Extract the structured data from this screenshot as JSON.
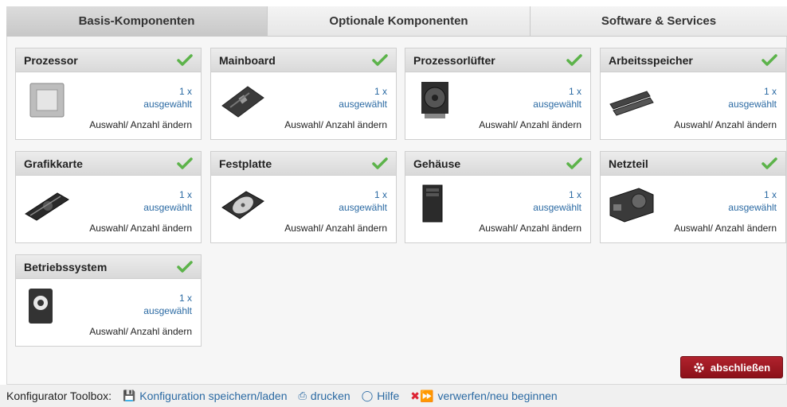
{
  "tabs": [
    {
      "label": "Basis-Komponenten",
      "active": true
    },
    {
      "label": "Optionale Komponenten",
      "active": false
    },
    {
      "label": "Software & Services",
      "active": false
    }
  ],
  "cards": [
    {
      "title": "Prozessor",
      "qty": "1 x",
      "selected": "ausgewählt",
      "change": "Auswahl/ Anzahl ändern",
      "icon": "cpu-icon"
    },
    {
      "title": "Mainboard",
      "qty": "1 x",
      "selected": "ausgewählt",
      "change": "Auswahl/ Anzahl ändern",
      "icon": "motherboard-icon"
    },
    {
      "title": "Prozessorlüfter",
      "qty": "1 x",
      "selected": "ausgewählt",
      "change": "Auswahl/ Anzahl ändern",
      "icon": "cpu-cooler-icon"
    },
    {
      "title": "Arbeitsspeicher",
      "qty": "1 x",
      "selected": "ausgewählt",
      "change": "Auswahl/ Anzahl ändern",
      "icon": "ram-icon"
    },
    {
      "title": "Grafikkarte",
      "qty": "1 x",
      "selected": "ausgewählt",
      "change": "Auswahl/ Anzahl ändern",
      "icon": "graphics-card-icon"
    },
    {
      "title": "Festplatte",
      "qty": "1 x",
      "selected": "ausgewählt",
      "change": "Auswahl/ Anzahl ändern",
      "icon": "hard-drive-icon"
    },
    {
      "title": "Gehäuse",
      "qty": "1 x",
      "selected": "ausgewählt",
      "change": "Auswahl/ Anzahl ändern",
      "icon": "pc-case-icon"
    },
    {
      "title": "Netzteil",
      "qty": "1 x",
      "selected": "ausgewählt",
      "change": "Auswahl/ Anzahl ändern",
      "icon": "power-supply-icon"
    },
    {
      "title": "Betriebssystem",
      "qty": "1 x",
      "selected": "ausgewählt",
      "change": "Auswahl/ Anzahl ändern",
      "icon": "os-gear-icon"
    }
  ],
  "finish_button": {
    "label": "abschließen",
    "icon": "gear-icon"
  },
  "toolbox": {
    "label": "Konfigurator Toolbox:",
    "save": {
      "label": "Konfiguration speichern/laden",
      "icon": "save-icon"
    },
    "print": {
      "label": "drucken",
      "icon": "print-icon"
    },
    "help": {
      "label": "Hilfe",
      "icon": "lightbulb-icon"
    },
    "reset": {
      "label": "verwerfen/neu beginnen",
      "icon": "discard-reset-icon"
    }
  },
  "colors": {
    "accent_link": "#2b6aa3",
    "check_green": "#5cb34a",
    "finish_red": "#9e1a23"
  }
}
